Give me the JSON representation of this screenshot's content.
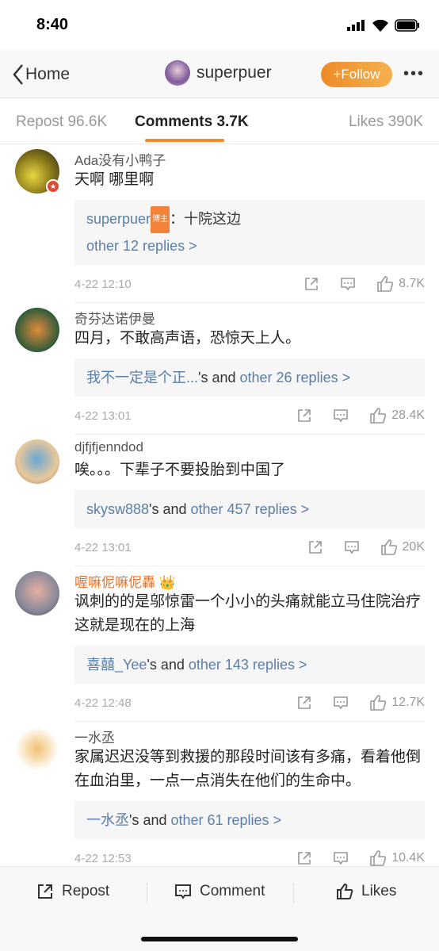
{
  "status": {
    "time": "8:40"
  },
  "nav": {
    "back_label": "Home",
    "username": "superpuer",
    "follow_label": "Follow",
    "more_icon": "more-dots-icon"
  },
  "tabs": [
    {
      "label": "Repost 96.6K"
    },
    {
      "label": "Comments 3.7K",
      "active": true
    },
    {
      "label": "Likes 390K"
    }
  ],
  "colors": {
    "accent": "#ef8a2e",
    "link": "#5b7ea6",
    "vip_name": "#e8742a"
  },
  "comments": [
    {
      "name": "Ada没有小鸭子",
      "text": "天啊 哪里啊",
      "reply_user": "superpuer",
      "reply_tag": "博主",
      "reply_text": "：十院这边",
      "reply_more": "other 12 replies >",
      "date": "4-22 12:10",
      "likes": "8.7K"
    },
    {
      "name": "奇芬达诺伊曼",
      "text": "四月，不敢高声语，恐惊天上人。",
      "reply_user": "我不一定是个正...",
      "reply_mid": "'s and ",
      "reply_more": "other 26 replies >",
      "date": "4-22 13:01",
      "likes": "28.4K"
    },
    {
      "name": "djfjfjenndod",
      "text": "唉。。。下辈子不要投胎到中国了",
      "reply_user": "skysw888",
      "reply_mid": "'s and ",
      "reply_more": "other 457 replies >",
      "date": "4-22 13:01",
      "likes": "20K"
    },
    {
      "name": "喔嘛伲嘛伲轟",
      "text": "讽刺的的是邬惊雷一个小小的头痛就能立马住院治疗 这就是现在的上海",
      "reply_user": "喜囍_Yee",
      "reply_mid": "'s and ",
      "reply_more": "other 143 replies >",
      "date": "4-22 12:48",
      "likes": "12.7K"
    },
    {
      "name": "一水丞",
      "text": "家属迟迟没等到救援的那段时间该有多痛，看着他倒在血泊里，一点一点消失在他们的生命中。",
      "reply_user": "一水丞",
      "reply_mid": "'s and ",
      "reply_more": "other 61 replies >",
      "date": "4-22 12:53",
      "likes": "10.4K"
    }
  ],
  "bottom": {
    "repost": "Repost",
    "comment": "Comment",
    "likes": "Likes"
  }
}
